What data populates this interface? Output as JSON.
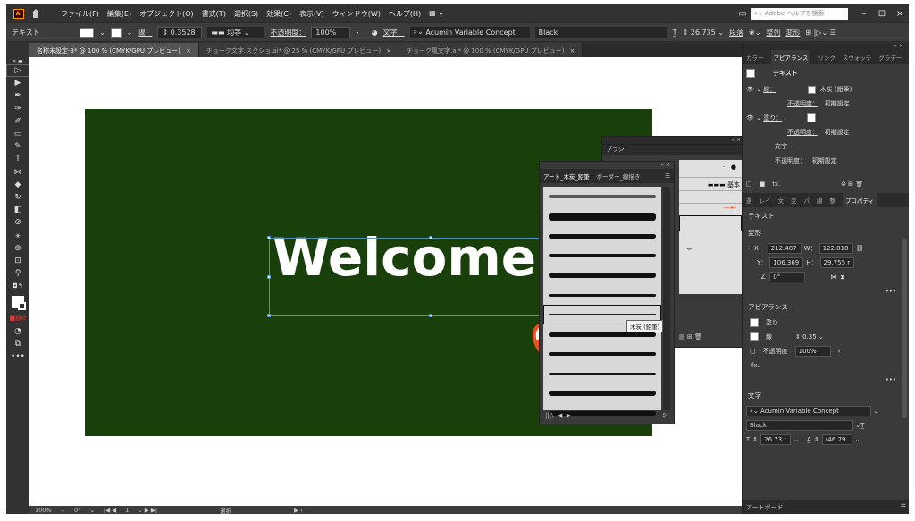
{
  "menubar": {
    "app_badge": "Ai",
    "menus": [
      "ファイル(F)",
      "編集(E)",
      "オブジェクト(O)",
      "書式(T)",
      "選択(S)",
      "効果(C)",
      "表示(V)",
      "ウィンドウ(W)",
      "ヘルプ(H)"
    ],
    "search_placeholder": "Adobe ヘルプを検索",
    "window_controls": [
      "–",
      "⊡",
      "×"
    ]
  },
  "control_bar": {
    "object_type": "テキスト",
    "stroke_label": "線：",
    "stroke_weight": "0.3528",
    "stroke_profile": "均等",
    "opacity_label": "不透明度：",
    "opacity_value": "100%",
    "char_label": "文字：",
    "font_family": "Acumin Variable Concept",
    "font_style": "Black",
    "font_size": "26.735",
    "paragraph_label": "段落",
    "align_label": "整列",
    "transform_label": "変形"
  },
  "document_tabs": [
    {
      "label": "名称未設定-3* @ 100 % (CMYK/GPU プレビュー)",
      "active": true
    },
    {
      "label": "チョーク文字.スクショ.ai* @ 25 % (CMYK/GPU プレビュー)",
      "active": false
    },
    {
      "label": "チョーク風文字.ai* @ 100 % (CMYK/GPU プレビュー)",
      "active": false
    }
  ],
  "canvas": {
    "artboard_color": "#193f0a",
    "text_content": "Welcome"
  },
  "brush_panel_back": {
    "title": "ブラシ",
    "basic_label": "基本"
  },
  "brush_panel_front": {
    "tabs": [
      "アート_木炭_鉛筆",
      "ボーダー_線描き"
    ],
    "tooltip": "木炭 (鉛筆)",
    "brush_count": 12,
    "selected_index": 6
  },
  "status_bar": {
    "zoom": "100%",
    "rotation": "0°",
    "artboard_num": "1",
    "tool_name": "選択"
  },
  "right_panel": {
    "tabs": [
      "カラー",
      "アピアランス",
      "リンク",
      "スウォッチ",
      "グラデー"
    ],
    "appearance": {
      "object": "テキスト",
      "stroke_label": "線：",
      "stroke_value": "木炭 (鉛筆)",
      "opacity_label": "不透明度：",
      "opacity_value": "初期設定",
      "fill_label": "塗り：",
      "char_label": "文字"
    },
    "lower_tabs": [
      "選",
      "レイ",
      "文",
      "変",
      "パ",
      "線",
      "整",
      "プロパティ"
    ],
    "properties": {
      "section_text": "テキスト",
      "section_transform": "変形",
      "x_label": "X：",
      "x_value": "212.487",
      "w_label": "W：",
      "w_value": "122.818",
      "y_label": "Y：",
      "y_value": "106.369",
      "h_label": "H：",
      "h_value": "29.755 r",
      "angle_value": "0°",
      "section_appearance": "アピアランス",
      "fill_label": "塗り",
      "stroke_label": "線",
      "stroke_weight": "0.35",
      "opacity_label": "不透明度",
      "opacity_value": "100%",
      "fx_label": "fx.",
      "section_char": "文字",
      "font_family": "Acumin Variable Concept",
      "font_style": "Black",
      "font_size": "26.73 t",
      "leading": "(46.79",
      "artboard_label": "アートボード"
    }
  },
  "colors": {
    "chrome": "#323232",
    "artboard": "#193f0a",
    "hand_accent": "#e5521f"
  }
}
